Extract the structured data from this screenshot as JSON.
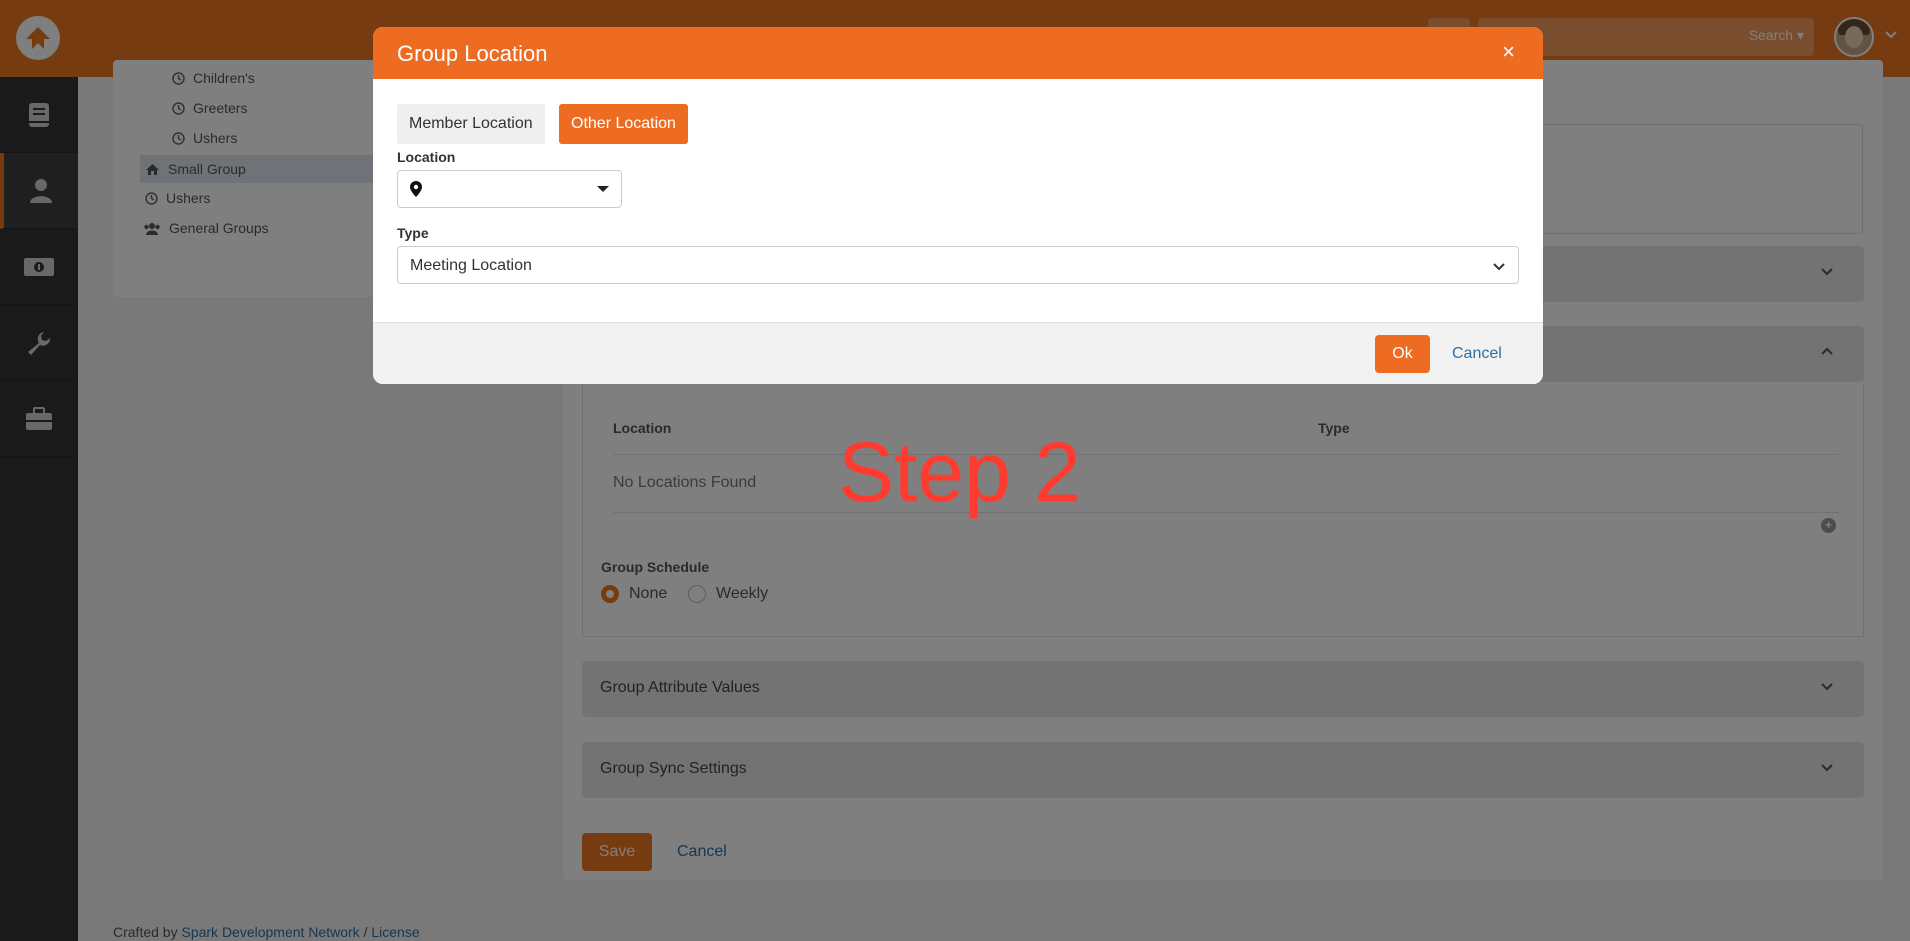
{
  "header": {
    "search_label": "Search ▾"
  },
  "nav": {
    "items": [
      {
        "icon": "book-icon"
      },
      {
        "icon": "person-icon"
      },
      {
        "icon": "money-icon"
      },
      {
        "icon": "wrench-icon"
      },
      {
        "icon": "briefcase-icon"
      }
    ]
  },
  "tree": {
    "items": [
      {
        "label": "Children's"
      },
      {
        "label": "Greeters"
      },
      {
        "label": "Ushers"
      },
      {
        "label": "Small Group"
      },
      {
        "label": "Ushers"
      },
      {
        "label": "General Groups"
      }
    ]
  },
  "main": {
    "sections": {
      "attributes": "Group Attribute Values",
      "sync": "Group Sync Settings"
    },
    "locations_table": {
      "col_location": "Location",
      "col_type": "Type",
      "empty": "No Locations Found"
    },
    "schedule": {
      "label": "Group Schedule",
      "option_none": "None",
      "option_weekly": "Weekly"
    },
    "save_label": "Save",
    "cancel_label": "Cancel"
  },
  "footer": {
    "prefix": "Crafted by ",
    "link1": "Spark Development Network",
    "sep": " / ",
    "link2": "License"
  },
  "annotation": {
    "step": "Step 2"
  },
  "modal": {
    "title": "Group Location",
    "close": "×",
    "toggle_member": "Member Location",
    "toggle_other": "Other Location",
    "location_label": "Location",
    "type_label": "Type",
    "type_value": "Meeting Location",
    "ok_label": "Ok",
    "cancel_label": "Cancel"
  },
  "colors": {
    "accent": "#ee6c22",
    "link": "#2f6ea5",
    "annotation": "#ff3b2f"
  }
}
